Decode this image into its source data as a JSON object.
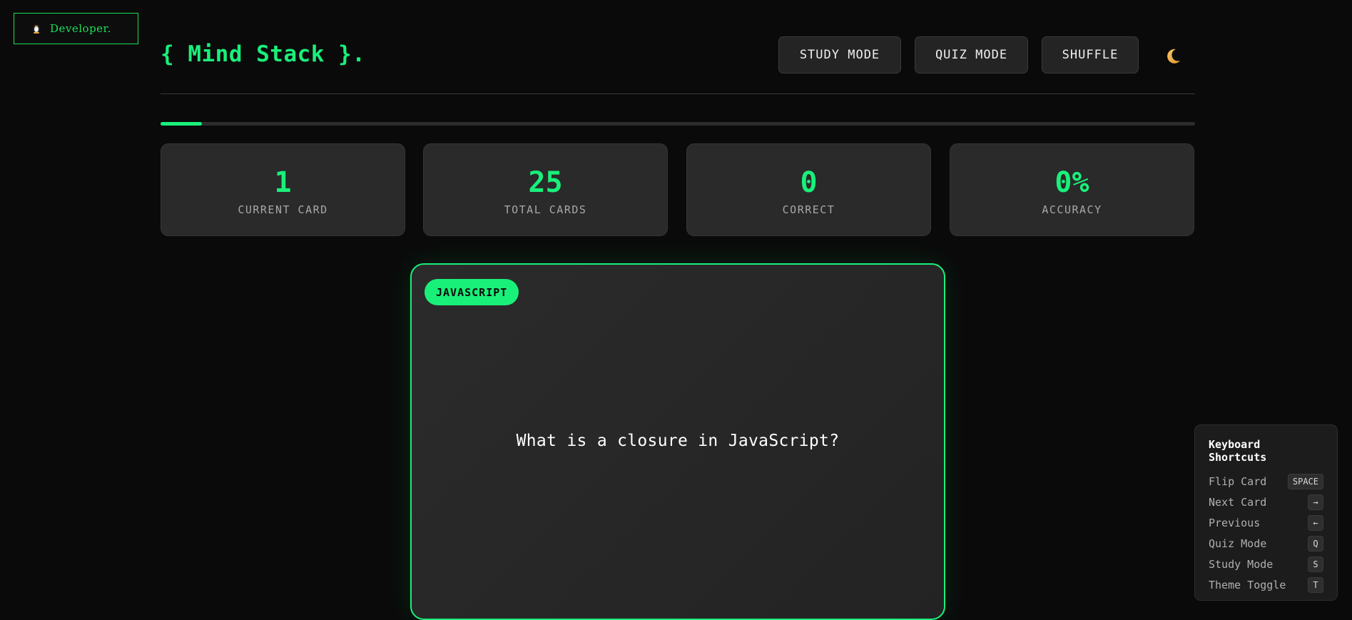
{
  "badge": {
    "icon": "penguin-icon",
    "label": "Developer."
  },
  "header": {
    "logo": "{ Mind Stack }.",
    "buttons": {
      "study": "STUDY MODE",
      "quiz": "QUIZ MODE",
      "shuffle": "SHUFFLE"
    },
    "theme_icon": "moon-icon"
  },
  "progress": {
    "percent": 4
  },
  "stats": [
    {
      "value": "1",
      "label": "CURRENT CARD"
    },
    {
      "value": "25",
      "label": "TOTAL CARDS"
    },
    {
      "value": "0",
      "label": "CORRECT"
    },
    {
      "value": "0%",
      "label": "ACCURACY"
    }
  ],
  "card": {
    "tag": "JAVASCRIPT",
    "question": "What is a closure in JavaScript?"
  },
  "shortcuts": {
    "title": "Keyboard Shortcuts",
    "items": [
      {
        "label": "Flip Card",
        "key": "SPACE"
      },
      {
        "label": "Next Card",
        "key": "→"
      },
      {
        "label": "Previous",
        "key": "←"
      },
      {
        "label": "Quiz Mode",
        "key": "Q"
      },
      {
        "label": "Study Mode",
        "key": "S"
      },
      {
        "label": "Theme Toggle",
        "key": "T"
      }
    ]
  },
  "colors": {
    "accent": "#19f07a",
    "background": "#0a0a0a",
    "panel": "#2a2a2a"
  }
}
